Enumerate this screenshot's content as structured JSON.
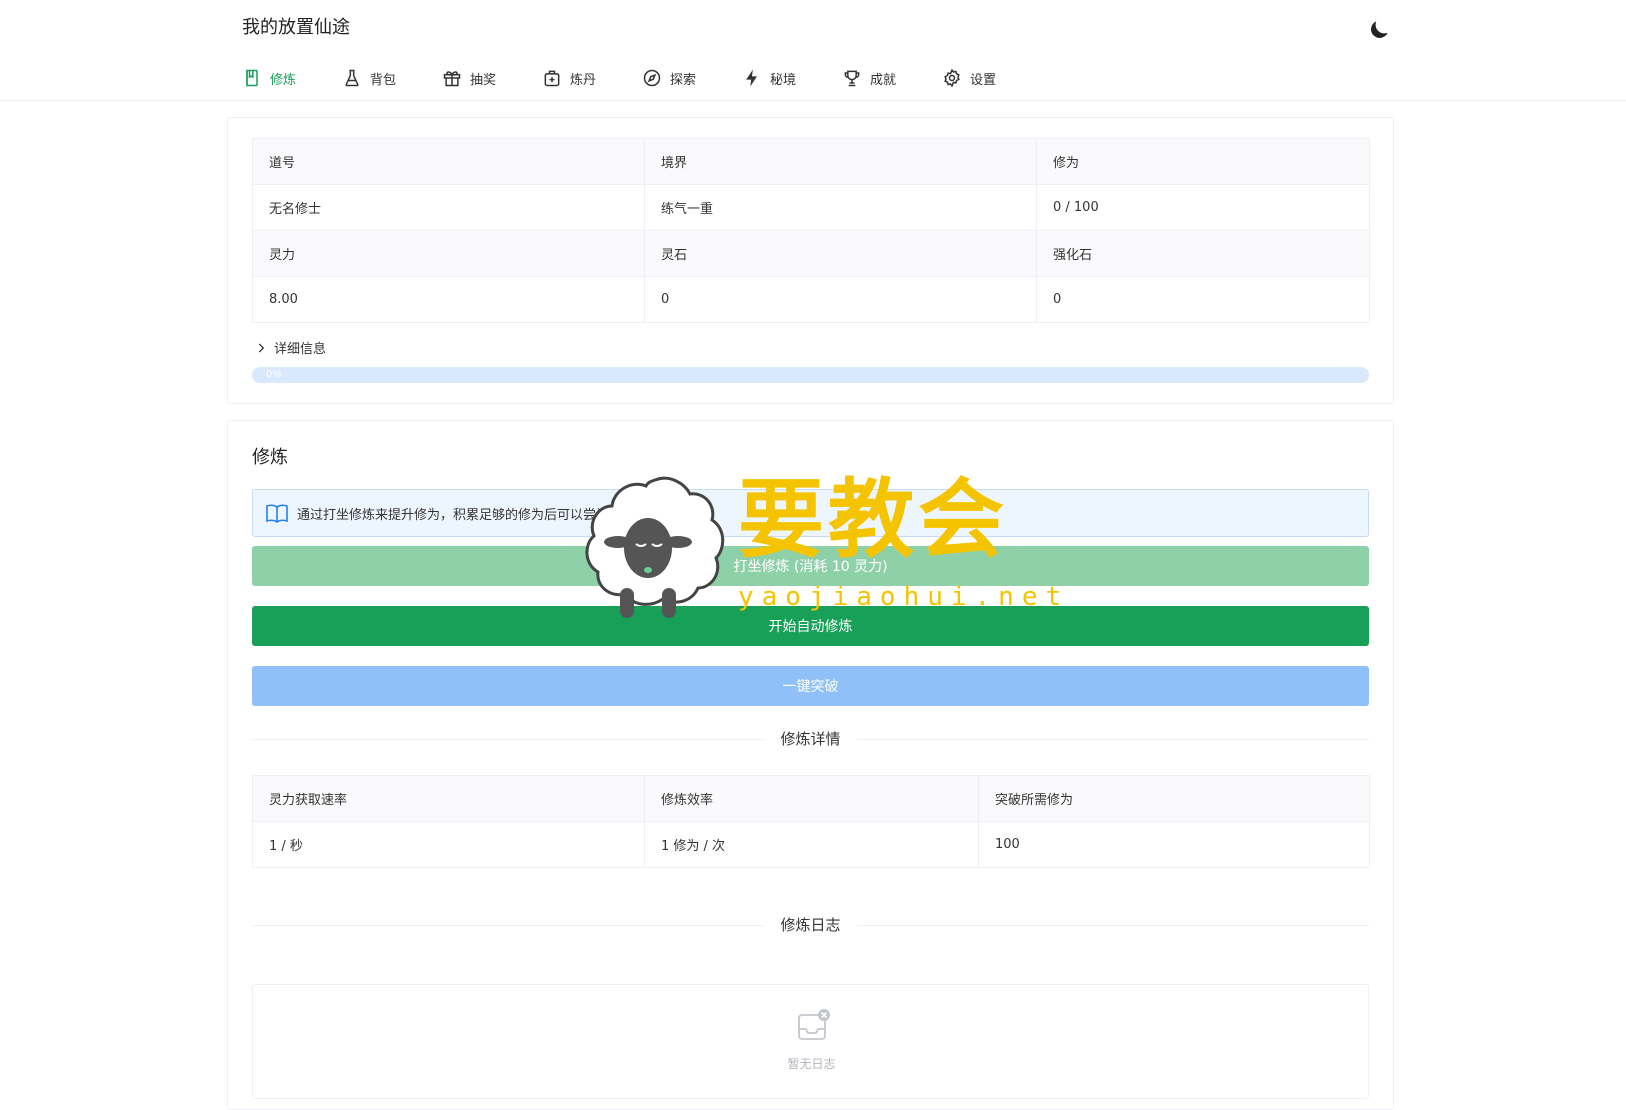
{
  "app": {
    "title": "我的放置仙途"
  },
  "nav": [
    {
      "label": "修炼",
      "icon": "book-icon",
      "active": true
    },
    {
      "label": "背包",
      "icon": "flask-icon"
    },
    {
      "label": "抽奖",
      "icon": "gift-icon"
    },
    {
      "label": "炼丹",
      "icon": "medkit-icon"
    },
    {
      "label": "探索",
      "icon": "compass-icon"
    },
    {
      "label": "秘境",
      "icon": "lightning-icon"
    },
    {
      "label": "成就",
      "icon": "trophy-icon"
    },
    {
      "label": "设置",
      "icon": "gear-icon"
    }
  ],
  "stats": {
    "headers1": [
      "道号",
      "境界",
      "修为"
    ],
    "values1": [
      "无名修士",
      "练气一重",
      "0 / 100"
    ],
    "headers2": [
      "灵力",
      "灵石",
      "强化石"
    ],
    "values2": [
      "8.00",
      "0",
      "0"
    ],
    "details_label": "详细信息",
    "progress": {
      "value": 0,
      "text": "0%"
    }
  },
  "cultivation": {
    "title": "修炼",
    "alert": "通过打坐修炼来提升修为，积累足够的修为后可以尝试突破境界。",
    "buttons": {
      "meditate": "打坐修炼 (消耗 10 灵力)",
      "auto": "开始自动修炼",
      "breakthrough": "一键突破"
    },
    "details_title": "修炼详情",
    "details_headers": [
      "灵力获取速率",
      "修炼效率",
      "突破所需修为"
    ],
    "details_values": [
      "1 / 秒",
      "1 修为 / 次",
      "100"
    ],
    "log_title": "修炼日志",
    "log_empty": "暂无日志"
  },
  "watermark": {
    "cn": "要教会",
    "en": "yaojiaohui.net"
  },
  "colors": {
    "primary": "#18a058",
    "info": "#2080f0",
    "watermark": "#f5c400"
  }
}
